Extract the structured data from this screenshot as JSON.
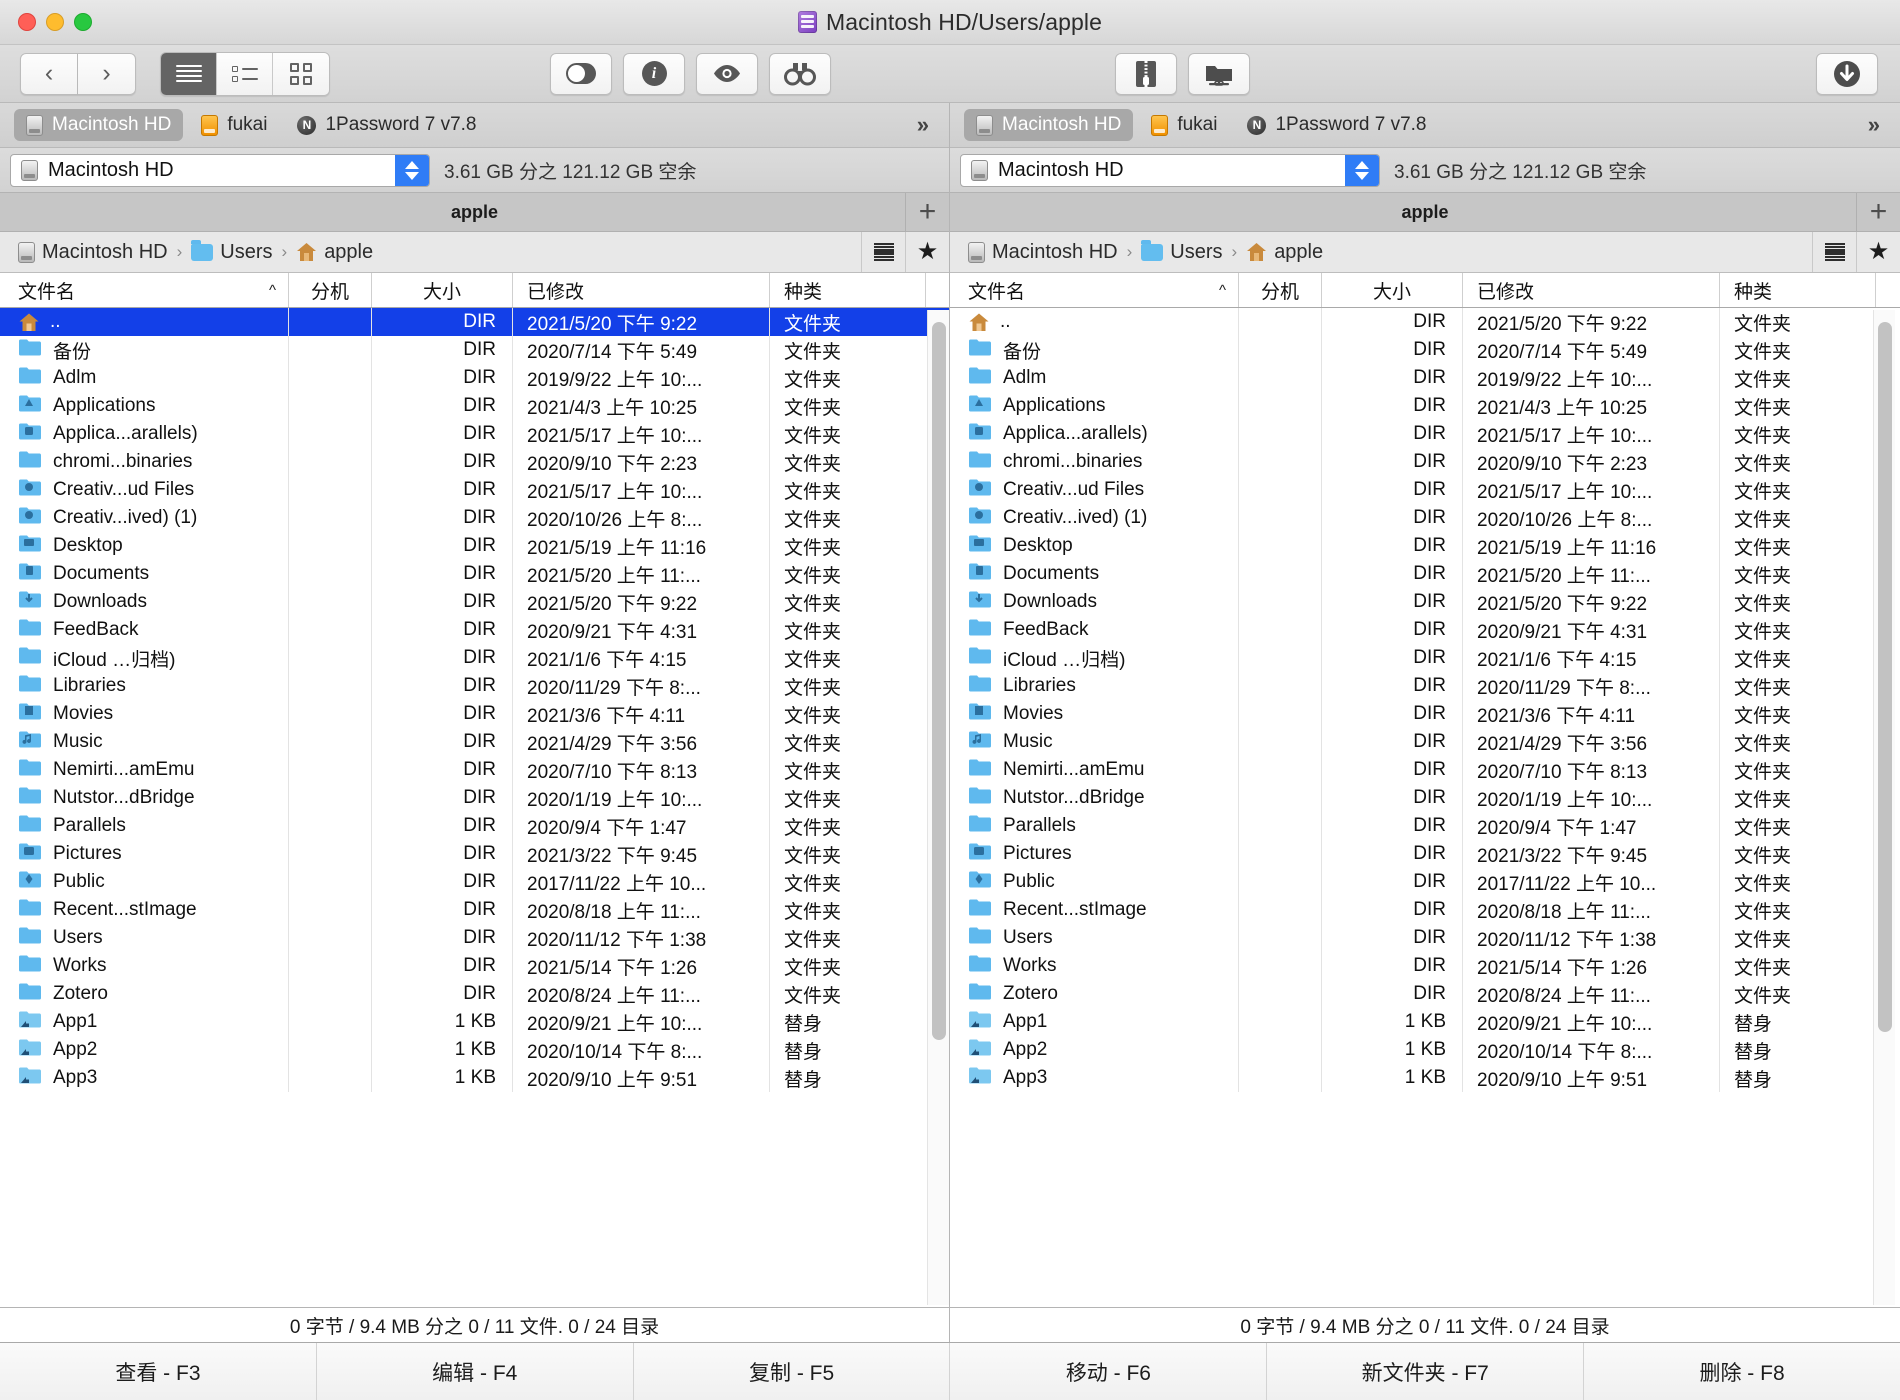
{
  "window": {
    "title": "Macintosh HD/Users/apple",
    "title_icon": "hard-disk-icon"
  },
  "toolbar": {
    "back_icon": "chevron-left-icon",
    "forward_icon": "chevron-right-icon",
    "view_list_icon": "list-view-icon",
    "view_detail_icon": "detail-view-icon",
    "view_grid_icon": "grid-view-icon",
    "toggle_icon": "toggle-switch-icon",
    "info_icon": "info-icon",
    "eye_icon": "quicklook-eye-icon",
    "binoculars_icon": "search-binoculars-icon",
    "zip_icon": "zip-archive-icon",
    "netfolder_icon": "network-folder-icon",
    "download_icon": "download-icon"
  },
  "panes": [
    {
      "id": "left",
      "tabs": [
        {
          "label": "Macintosh HD",
          "icon": "hard-disk-icon",
          "active": true
        },
        {
          "label": "fukai",
          "icon": "orange-disk-icon",
          "active": false
        },
        {
          "label": "1Password 7 v7.8",
          "icon": "onepassword-icon",
          "active": false
        }
      ],
      "overflow_label": "»",
      "drive": {
        "selected": "Macintosh HD",
        "icon": "hard-disk-icon",
        "free_space": "3.61 GB 分之 121.12 GB 空余"
      },
      "folder_tab": {
        "label": "apple",
        "add_label": "+"
      },
      "breadcrumb": [
        {
          "label": "Macintosh HD",
          "icon": "hard-disk-icon"
        },
        {
          "label": "Users",
          "icon": "users-folder-icon"
        },
        {
          "label": "apple",
          "icon": "home-folder-icon"
        }
      ],
      "breadcrumb_sep": "›",
      "crumb_icons": {
        "list": "hamburger-icon",
        "favorite": "star-icon"
      },
      "columns": [
        {
          "key": "name",
          "label": "文件名",
          "sort": "^"
        },
        {
          "key": "ext",
          "label": "分机"
        },
        {
          "key": "size",
          "label": "大小"
        },
        {
          "key": "mod",
          "label": "已修改"
        },
        {
          "key": "kind",
          "label": "种类"
        }
      ],
      "selected_index": 0,
      "rows": [
        {
          "icon": "home-folder-icon",
          "name": "..",
          "ext": "",
          "size": "DIR",
          "mod": "2021/5/20 下午 9:22",
          "kind": "文件夹"
        },
        {
          "icon": "folder-icon",
          "name": "备份",
          "ext": "",
          "size": "DIR",
          "mod": "2020/7/14 下午 5:49",
          "kind": "文件夹"
        },
        {
          "icon": "folder-icon",
          "name": "Adlm",
          "ext": "",
          "size": "DIR",
          "mod": "2019/9/22 上午 10:...",
          "kind": "文件夹"
        },
        {
          "icon": "applications-folder-icon",
          "name": "Applications",
          "ext": "",
          "size": "DIR",
          "mod": "2021/4/3 上午 10:25",
          "kind": "文件夹"
        },
        {
          "icon": "parallels-folder-icon",
          "name": "Applica...arallels)",
          "ext": "",
          "size": "DIR",
          "mod": "2021/5/17 上午 10:...",
          "kind": "文件夹"
        },
        {
          "icon": "folder-icon",
          "name": "chromi...binaries",
          "ext": "",
          "size": "DIR",
          "mod": "2020/9/10 下午 2:23",
          "kind": "文件夹"
        },
        {
          "icon": "creative-cloud-folder-icon",
          "name": "Creativ...ud Files",
          "ext": "",
          "size": "DIR",
          "mod": "2021/5/17 上午 10:...",
          "kind": "文件夹"
        },
        {
          "icon": "creative-cloud-folder-icon",
          "name": "Creativ...ived) (1)",
          "ext": "",
          "size": "DIR",
          "mod": "2020/10/26 上午 8:...",
          "kind": "文件夹"
        },
        {
          "icon": "desktop-folder-icon",
          "name": "Desktop",
          "ext": "",
          "size": "DIR",
          "mod": "2021/5/19 上午 11:16",
          "kind": "文件夹"
        },
        {
          "icon": "documents-folder-icon",
          "name": "Documents",
          "ext": "",
          "size": "DIR",
          "mod": "2021/5/20 上午 11:...",
          "kind": "文件夹"
        },
        {
          "icon": "downloads-folder-icon",
          "name": "Downloads",
          "ext": "",
          "size": "DIR",
          "mod": "2021/5/20 下午 9:22",
          "kind": "文件夹"
        },
        {
          "icon": "folder-icon",
          "name": "FeedBack",
          "ext": "",
          "size": "DIR",
          "mod": "2020/9/21 下午 4:31",
          "kind": "文件夹"
        },
        {
          "icon": "folder-icon",
          "name": "iCloud …归档)",
          "ext": "",
          "size": "DIR",
          "mod": "2021/1/6 下午 4:15",
          "kind": "文件夹"
        },
        {
          "icon": "folder-icon",
          "name": "Libraries",
          "ext": "",
          "size": "DIR",
          "mod": "2020/11/29 下午 8:...",
          "kind": "文件夹"
        },
        {
          "icon": "movies-folder-icon",
          "name": "Movies",
          "ext": "",
          "size": "DIR",
          "mod": "2021/3/6 下午 4:11",
          "kind": "文件夹"
        },
        {
          "icon": "music-folder-icon",
          "name": "Music",
          "ext": "",
          "size": "DIR",
          "mod": "2021/4/29 下午 3:56",
          "kind": "文件夹"
        },
        {
          "icon": "folder-icon",
          "name": "Nemirti...amEmu",
          "ext": "",
          "size": "DIR",
          "mod": "2020/7/10 下午 8:13",
          "kind": "文件夹"
        },
        {
          "icon": "folder-icon",
          "name": "Nutstor...dBridge",
          "ext": "",
          "size": "DIR",
          "mod": "2020/1/19 上午 10:...",
          "kind": "文件夹"
        },
        {
          "icon": "folder-icon",
          "name": "Parallels",
          "ext": "",
          "size": "DIR",
          "mod": "2020/9/4 下午 1:47",
          "kind": "文件夹"
        },
        {
          "icon": "pictures-folder-icon",
          "name": "Pictures",
          "ext": "",
          "size": "DIR",
          "mod": "2021/3/22 下午 9:45",
          "kind": "文件夹"
        },
        {
          "icon": "public-folder-icon",
          "name": "Public",
          "ext": "",
          "size": "DIR",
          "mod": "2017/11/22 上午 10...",
          "kind": "文件夹"
        },
        {
          "icon": "folder-icon",
          "name": "Recent...stImage",
          "ext": "",
          "size": "DIR",
          "mod": "2020/8/18 上午 11:...",
          "kind": "文件夹"
        },
        {
          "icon": "folder-icon",
          "name": "Users",
          "ext": "",
          "size": "DIR",
          "mod": "2020/11/12 下午 1:38",
          "kind": "文件夹"
        },
        {
          "icon": "folder-icon",
          "name": "Works",
          "ext": "",
          "size": "DIR",
          "mod": "2021/5/14 下午 1:26",
          "kind": "文件夹"
        },
        {
          "icon": "folder-icon",
          "name": "Zotero",
          "ext": "",
          "size": "DIR",
          "mod": "2020/8/24 上午 11:...",
          "kind": "文件夹"
        },
        {
          "icon": "alias-folder-icon",
          "name": "App1",
          "ext": "",
          "size": "1 KB",
          "mod": "2020/9/21 上午 10:...",
          "kind": "替身"
        },
        {
          "icon": "alias-folder-icon",
          "name": "App2",
          "ext": "",
          "size": "1 KB",
          "mod": "2020/10/14 下午 8:...",
          "kind": "替身"
        },
        {
          "icon": "alias-folder-icon",
          "name": "App3",
          "ext": "",
          "size": "1 KB",
          "mod": "2020/9/10 上午 9:51",
          "kind": "替身"
        }
      ],
      "status": "0 字节 / 9.4 MB 分之 0 / 11 文件. 0 / 24 目录"
    },
    {
      "id": "right",
      "tabs": [
        {
          "label": "Macintosh HD",
          "icon": "hard-disk-icon",
          "active": true
        },
        {
          "label": "fukai",
          "icon": "orange-disk-icon",
          "active": false
        },
        {
          "label": "1Password 7 v7.8",
          "icon": "onepassword-icon",
          "active": false
        }
      ],
      "overflow_label": "»",
      "drive": {
        "selected": "Macintosh HD",
        "icon": "hard-disk-icon",
        "free_space": "3.61 GB 分之 121.12 GB 空余"
      },
      "folder_tab": {
        "label": "apple",
        "add_label": "+"
      },
      "breadcrumb": [
        {
          "label": "Macintosh HD",
          "icon": "hard-disk-icon"
        },
        {
          "label": "Users",
          "icon": "users-folder-icon"
        },
        {
          "label": "apple",
          "icon": "home-folder-icon"
        }
      ],
      "breadcrumb_sep": "›",
      "crumb_icons": {
        "list": "hamburger-icon",
        "favorite": "star-icon"
      },
      "columns": [
        {
          "key": "name",
          "label": "文件名",
          "sort": "^"
        },
        {
          "key": "ext",
          "label": "分机"
        },
        {
          "key": "size",
          "label": "大小"
        },
        {
          "key": "mod",
          "label": "已修改"
        },
        {
          "key": "kind",
          "label": "种类"
        }
      ],
      "selected_index": -1,
      "rows": [
        {
          "icon": "home-folder-icon",
          "name": "..",
          "ext": "",
          "size": "DIR",
          "mod": "2021/5/20 下午 9:22",
          "kind": "文件夹"
        },
        {
          "icon": "folder-icon",
          "name": "备份",
          "ext": "",
          "size": "DIR",
          "mod": "2020/7/14 下午 5:49",
          "kind": "文件夹"
        },
        {
          "icon": "folder-icon",
          "name": "Adlm",
          "ext": "",
          "size": "DIR",
          "mod": "2019/9/22 上午 10:...",
          "kind": "文件夹"
        },
        {
          "icon": "applications-folder-icon",
          "name": "Applications",
          "ext": "",
          "size": "DIR",
          "mod": "2021/4/3 上午 10:25",
          "kind": "文件夹"
        },
        {
          "icon": "parallels-folder-icon",
          "name": "Applica...arallels)",
          "ext": "",
          "size": "DIR",
          "mod": "2021/5/17 上午 10:...",
          "kind": "文件夹"
        },
        {
          "icon": "folder-icon",
          "name": "chromi...binaries",
          "ext": "",
          "size": "DIR",
          "mod": "2020/9/10 下午 2:23",
          "kind": "文件夹"
        },
        {
          "icon": "creative-cloud-folder-icon",
          "name": "Creativ...ud Files",
          "ext": "",
          "size": "DIR",
          "mod": "2021/5/17 上午 10:...",
          "kind": "文件夹"
        },
        {
          "icon": "creative-cloud-folder-icon",
          "name": "Creativ...ived) (1)",
          "ext": "",
          "size": "DIR",
          "mod": "2020/10/26 上午 8:...",
          "kind": "文件夹"
        },
        {
          "icon": "desktop-folder-icon",
          "name": "Desktop",
          "ext": "",
          "size": "DIR",
          "mod": "2021/5/19 上午 11:16",
          "kind": "文件夹"
        },
        {
          "icon": "documents-folder-icon",
          "name": "Documents",
          "ext": "",
          "size": "DIR",
          "mod": "2021/5/20 上午 11:...",
          "kind": "文件夹"
        },
        {
          "icon": "downloads-folder-icon",
          "name": "Downloads",
          "ext": "",
          "size": "DIR",
          "mod": "2021/5/20 下午 9:22",
          "kind": "文件夹"
        },
        {
          "icon": "folder-icon",
          "name": "FeedBack",
          "ext": "",
          "size": "DIR",
          "mod": "2020/9/21 下午 4:31",
          "kind": "文件夹"
        },
        {
          "icon": "folder-icon",
          "name": "iCloud …归档)",
          "ext": "",
          "size": "DIR",
          "mod": "2021/1/6 下午 4:15",
          "kind": "文件夹"
        },
        {
          "icon": "folder-icon",
          "name": "Libraries",
          "ext": "",
          "size": "DIR",
          "mod": "2020/11/29 下午 8:...",
          "kind": "文件夹"
        },
        {
          "icon": "movies-folder-icon",
          "name": "Movies",
          "ext": "",
          "size": "DIR",
          "mod": "2021/3/6 下午 4:11",
          "kind": "文件夹"
        },
        {
          "icon": "music-folder-icon",
          "name": "Music",
          "ext": "",
          "size": "DIR",
          "mod": "2021/4/29 下午 3:56",
          "kind": "文件夹"
        },
        {
          "icon": "folder-icon",
          "name": "Nemirti...amEmu",
          "ext": "",
          "size": "DIR",
          "mod": "2020/7/10 下午 8:13",
          "kind": "文件夹"
        },
        {
          "icon": "folder-icon",
          "name": "Nutstor...dBridge",
          "ext": "",
          "size": "DIR",
          "mod": "2020/1/19 上午 10:...",
          "kind": "文件夹"
        },
        {
          "icon": "folder-icon",
          "name": "Parallels",
          "ext": "",
          "size": "DIR",
          "mod": "2020/9/4 下午 1:47",
          "kind": "文件夹"
        },
        {
          "icon": "pictures-folder-icon",
          "name": "Pictures",
          "ext": "",
          "size": "DIR",
          "mod": "2021/3/22 下午 9:45",
          "kind": "文件夹"
        },
        {
          "icon": "public-folder-icon",
          "name": "Public",
          "ext": "",
          "size": "DIR",
          "mod": "2017/11/22 上午 10...",
          "kind": "文件夹"
        },
        {
          "icon": "folder-icon",
          "name": "Recent...stImage",
          "ext": "",
          "size": "DIR",
          "mod": "2020/8/18 上午 11:...",
          "kind": "文件夹"
        },
        {
          "icon": "folder-icon",
          "name": "Users",
          "ext": "",
          "size": "DIR",
          "mod": "2020/11/12 下午 1:38",
          "kind": "文件夹"
        },
        {
          "icon": "folder-icon",
          "name": "Works",
          "ext": "",
          "size": "DIR",
          "mod": "2021/5/14 下午 1:26",
          "kind": "文件夹"
        },
        {
          "icon": "folder-icon",
          "name": "Zotero",
          "ext": "",
          "size": "DIR",
          "mod": "2020/8/24 上午 11:...",
          "kind": "文件夹"
        },
        {
          "icon": "alias-folder-icon",
          "name": "App1",
          "ext": "",
          "size": "1 KB",
          "mod": "2020/9/21 上午 10:...",
          "kind": "替身"
        },
        {
          "icon": "alias-folder-icon",
          "name": "App2",
          "ext": "",
          "size": "1 KB",
          "mod": "2020/10/14 下午 8:...",
          "kind": "替身"
        },
        {
          "icon": "alias-folder-icon",
          "name": "App3",
          "ext": "",
          "size": "1 KB",
          "mod": "2020/9/10 上午 9:51",
          "kind": "替身"
        }
      ],
      "status": "0 字节 / 9.4 MB 分之 0 / 11 文件. 0 / 24 目录"
    }
  ],
  "function_bar": [
    {
      "label": "查看 - F3"
    },
    {
      "label": "编辑 - F4"
    },
    {
      "label": "复制 - F5"
    },
    {
      "label": "移动 - F6"
    },
    {
      "label": "新文件夹 - F7"
    },
    {
      "label": "删除 - F8"
    }
  ],
  "colors": {
    "selection_blue": "#1340e8",
    "stepper_blue": "#2f7cf6",
    "folder_blue": "#5fb9ee",
    "title_icon_purple": "#7b3fbf"
  }
}
